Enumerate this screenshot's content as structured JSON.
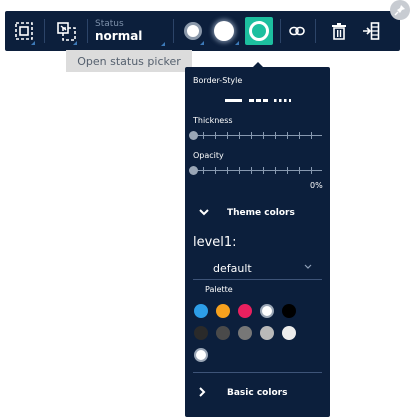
{
  "toolbar": {
    "status_label": "Status",
    "status_value": "normal",
    "icons": [
      "select-frame-icon",
      "group-select-icon",
      "fill-circle-icon",
      "stroke-circle-icon",
      "status-circle-icon",
      "link-icon",
      "delete-icon",
      "insert-right-icon"
    ]
  },
  "pin_icon": "pin-icon",
  "tooltip": {
    "text": "Open status picker"
  },
  "panel": {
    "border_style_label": "Border-Style",
    "thickness_label": "Thickness",
    "opacity_label": "Opacity",
    "opacity_value": "0%",
    "theme_colors_label": "Theme colors",
    "level_label": "level1:",
    "level_value": "default",
    "palette_label": "Palette",
    "basic_colors_label": "Basic colors",
    "palette_colors": [
      "#2d9ee8",
      "#f6a11e",
      "#e9205f",
      "#ffffff",
      "#000000",
      "#2a2a2a",
      "#4a4a4a",
      "#777777",
      "#b9b9b9",
      "#ececec",
      "#ffffff"
    ],
    "accent_color": "#1dbf9f",
    "background_color": "#0c1f3c"
  }
}
